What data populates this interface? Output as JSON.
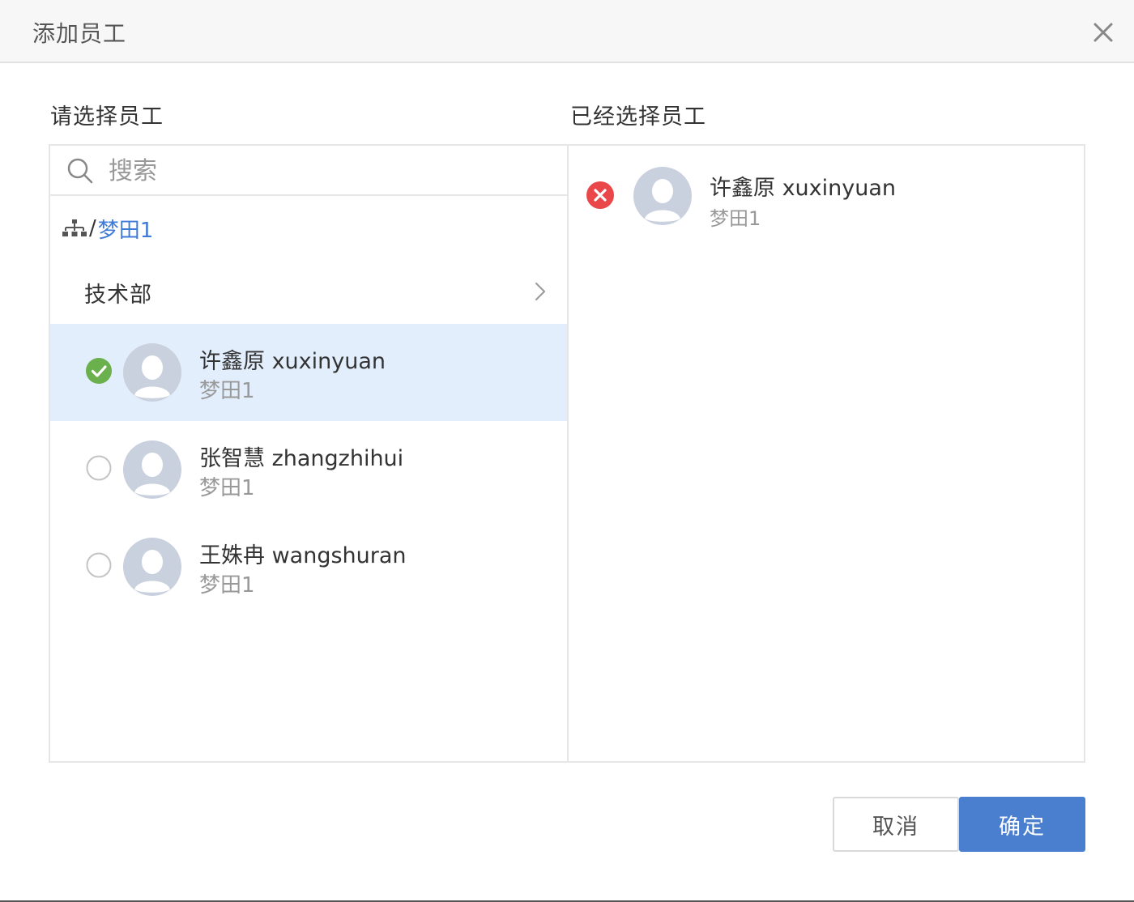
{
  "dialog": {
    "title": "添加员工",
    "close_icon": "close-icon"
  },
  "left": {
    "title": "请选择员工",
    "search_placeholder": "搜索",
    "breadcrumb": {
      "icon": "org-tree-icon",
      "separator": "/",
      "current": "梦田1"
    },
    "department": {
      "label": "技术部",
      "icon": "chevron-right-icon"
    },
    "employees": [
      {
        "name": "许鑫原 xuxinyuan",
        "org": "梦田1",
        "selected": true
      },
      {
        "name": "张智慧 zhangzhihui",
        "org": "梦田1",
        "selected": false
      },
      {
        "name": "王姝冉 wangshuran",
        "org": "梦田1",
        "selected": false
      }
    ]
  },
  "right": {
    "title": "已经选择员工",
    "selected": [
      {
        "name": "许鑫原 xuxinyuan",
        "org": "梦田1"
      }
    ]
  },
  "buttons": {
    "cancel": "取消",
    "confirm": "确定"
  },
  "colors": {
    "accent": "#4a7fd0",
    "link": "#3f7ad6",
    "selected_row": "#e3eefc",
    "check_green": "#6ab04c",
    "remove_red": "#e9474a",
    "avatar_bg": "#c9d0de"
  }
}
